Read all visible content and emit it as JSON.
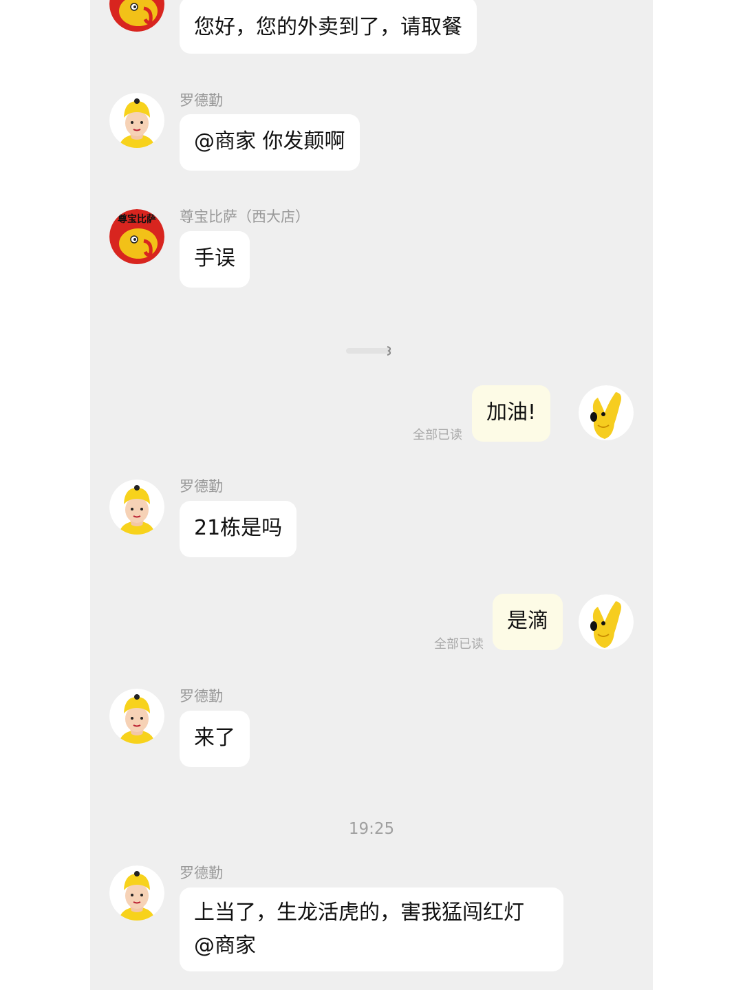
{
  "colors": {
    "chat_background": "#efefef",
    "incoming_bubble": "#ffffff",
    "outgoing_bubble": "#fdfbe6",
    "courier_helmet": "#f7d21c",
    "merchant_red": "#d8251f",
    "mascot_yellow": "#f6cd1f"
  },
  "messages": [
    {
      "sender": "",
      "text": "您好，您的外卖到了，请取餐",
      "avatar_icon": "pizza-elephant-logo"
    },
    {
      "sender": "罗德勤",
      "text": "@商家 你发颠啊",
      "avatar_icon": "courier-helmet-avatar"
    },
    {
      "sender": "尊宝比萨（西大店）",
      "text": "手误",
      "avatar_icon": "pizza-elephant-logo",
      "avatar_text": "尊宝比萨"
    },
    {
      "sender": "",
      "text": "加油!",
      "status": "全部已读",
      "avatar_icon": "yellow-mascot-avatar"
    },
    {
      "sender": "罗德勤",
      "text": "21栋是吗",
      "avatar_icon": "courier-helmet-avatar"
    },
    {
      "sender": "",
      "text": "是滴",
      "status": "全部已读",
      "avatar_icon": "yellow-mascot-avatar"
    },
    {
      "sender": "罗德勤",
      "text": "来了",
      "avatar_icon": "courier-helmet-avatar"
    },
    {
      "sender": "罗德勤",
      "text_line1": "上当了，生龙活虎的，害我猛闯红灯",
      "text_line2": "@商家",
      "avatar_icon": "courier-helmet-avatar"
    }
  ],
  "timestamp": "19:25"
}
